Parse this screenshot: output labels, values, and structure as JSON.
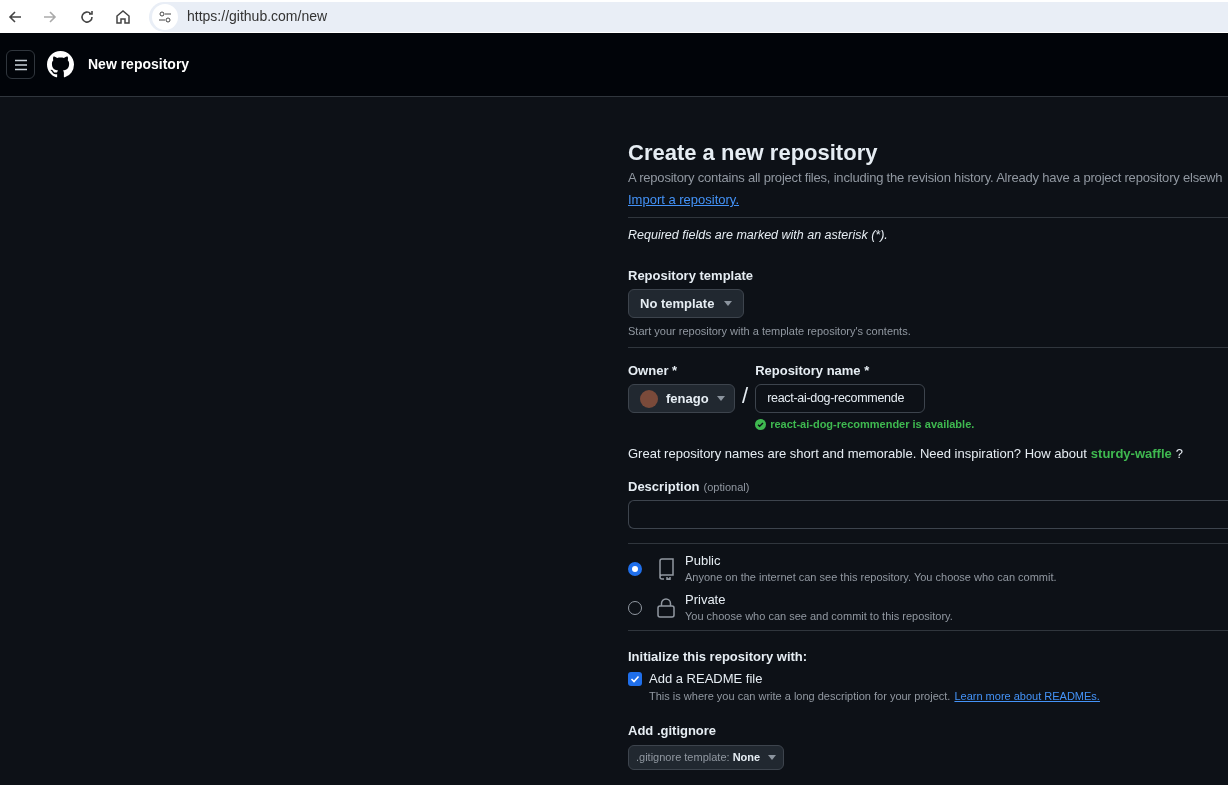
{
  "browser": {
    "url": "https://github.com/new"
  },
  "header": {
    "title": "New repository"
  },
  "form": {
    "title": "Create a new repository",
    "intro": "A repository contains all project files, including the revision history. Already have a project repository elsewh",
    "import_link": "Import a repository.",
    "required_note": "Required fields are marked with an asterisk (*).",
    "template": {
      "label": "Repository template",
      "value": "No template",
      "hint": "Start your repository with a template repository's contents."
    },
    "owner": {
      "label": "Owner *",
      "value": "fenago"
    },
    "separator": "/",
    "repo_name": {
      "label": "Repository name *",
      "value": "react-ai-dog-recommende",
      "availability": "react-ai-dog-recommender is available."
    },
    "suggestion": {
      "text": "Great repository names are short and memorable. Need inspiration? How about",
      "name": "sturdy-waffle",
      "suffix": "?"
    },
    "description": {
      "label": "Description",
      "optional": "(optional)"
    },
    "visibility": [
      {
        "kind": "repo",
        "label": "Public",
        "hint": "Anyone on the internet can see this repository. You choose who can commit.",
        "selected": true
      },
      {
        "kind": "lock",
        "label": "Private",
        "hint": "You choose who can see and commit to this repository.",
        "selected": false
      }
    ],
    "initialize": {
      "heading": "Initialize this repository with:",
      "readme": {
        "label": "Add a README file",
        "checked": true,
        "hint": "This is where you can write a long description for your project.",
        "link": "Learn more about READMEs."
      }
    },
    "gitignore": {
      "heading": "Add .gitignore",
      "label": ".gitignore template:",
      "value": "None"
    }
  }
}
